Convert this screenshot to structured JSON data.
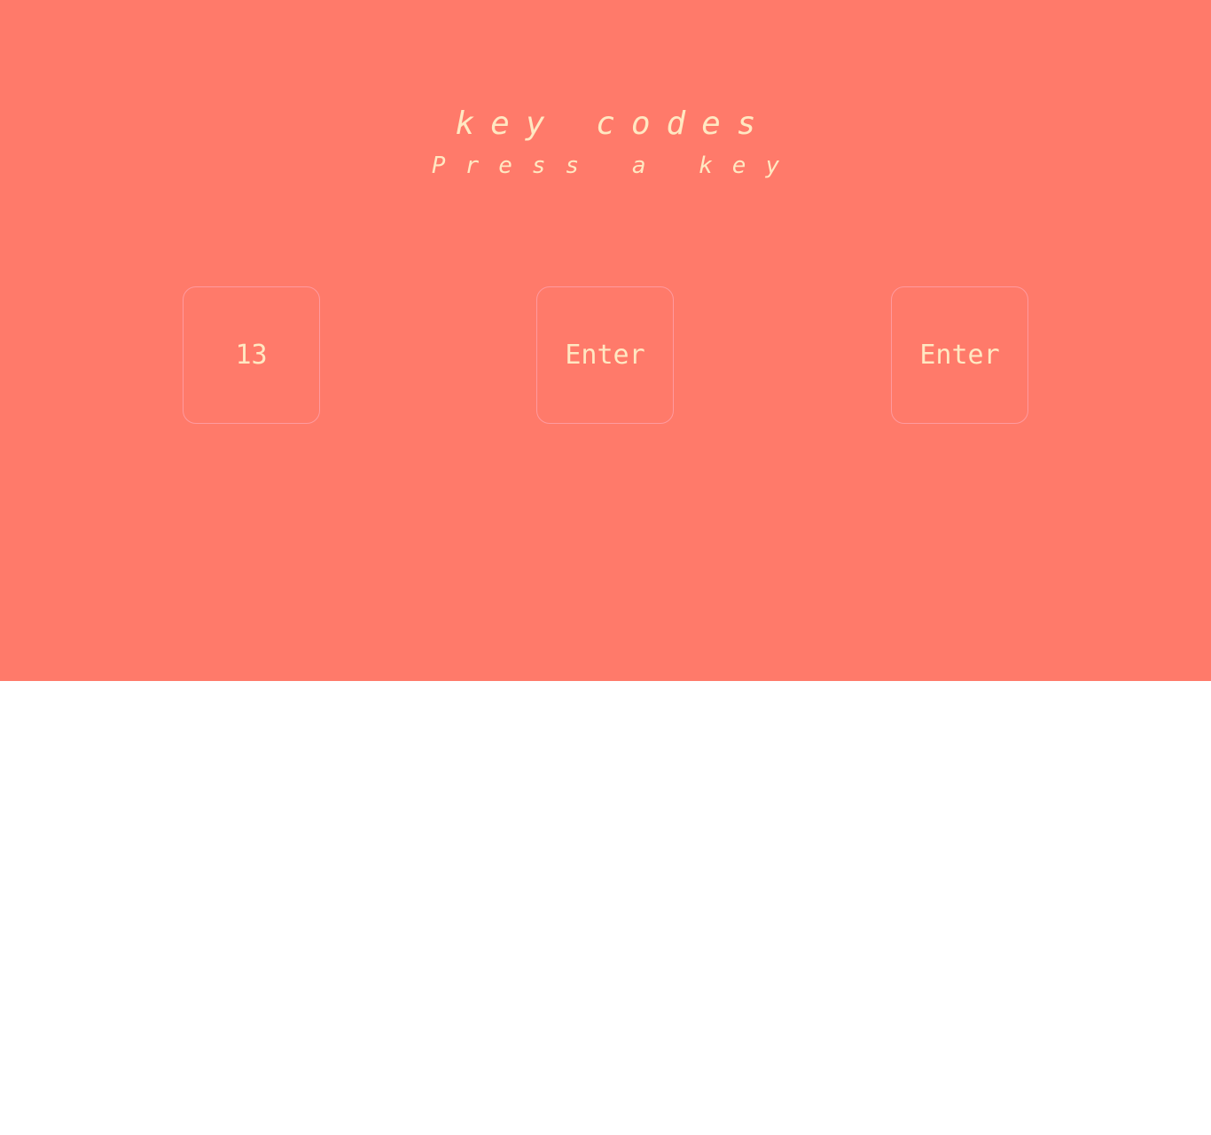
{
  "header": {
    "title": "Key Codes",
    "subtitle": "Press a key"
  },
  "keys": [
    {
      "value": "13"
    },
    {
      "value": "Enter"
    },
    {
      "value": "Enter"
    }
  ],
  "colors": {
    "background": "#ff7a6a",
    "text": "#ffe8c2",
    "box_border": "#ff9a9f"
  }
}
